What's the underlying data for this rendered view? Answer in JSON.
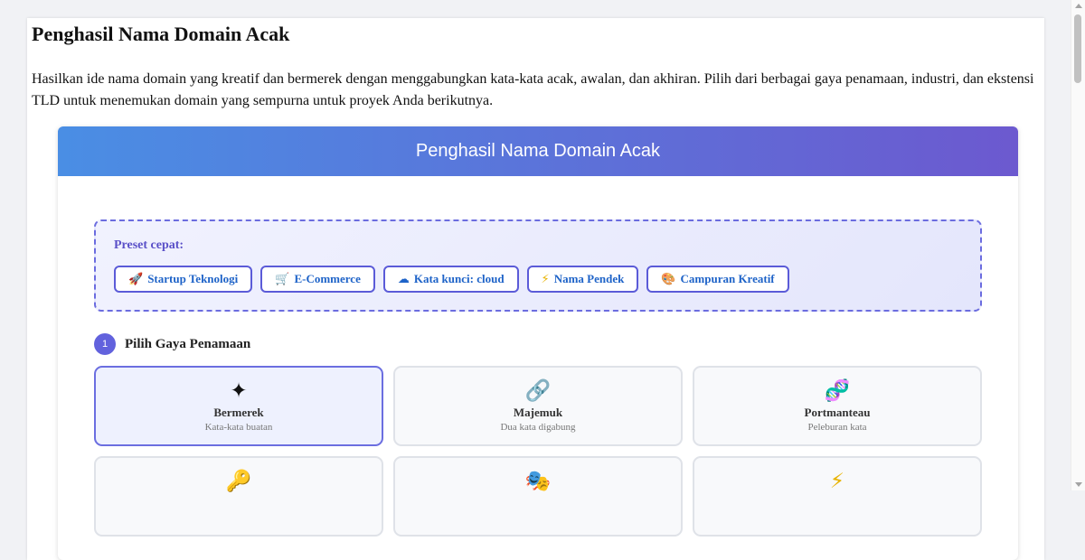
{
  "page": {
    "title": "Penghasil Nama Domain Acak",
    "intro": "Hasilkan ide nama domain yang kreatif dan bermerek dengan menggabungkan kata-kata acak, awalan, dan akhiran. Pilih dari berbagai gaya penamaan, industri, dan ekstensi TLD untuk menemukan domain yang sempurna untuk proyek Anda berikutnya."
  },
  "tool": {
    "header": "Penghasil Nama Domain Acak",
    "presets": {
      "label": "Preset cepat:",
      "items": [
        {
          "icon": "rocket-icon",
          "emoji": "🚀",
          "label": "Startup Teknologi"
        },
        {
          "icon": "cart-icon",
          "emoji": "🛒",
          "label": "E-Commerce"
        },
        {
          "icon": "cloud-icon",
          "emoji": "☁",
          "label": "Kata kunci: cloud"
        },
        {
          "icon": "lightning-icon",
          "emoji": "⚡",
          "label": "Nama Pendek"
        },
        {
          "icon": "palette-icon",
          "emoji": "🎨",
          "label": "Campuran Kreatif"
        }
      ]
    },
    "step1": {
      "number": "1",
      "label": "Pilih Gaya Penamaan",
      "selected": "Bermerek",
      "options": [
        {
          "icon": "sparkle-icon",
          "glyph": "✦",
          "name": "Bermerek",
          "desc": "Kata-kata buatan"
        },
        {
          "icon": "link-icon",
          "glyph": "🔗",
          "name": "Majemuk",
          "desc": "Dua kata digabung"
        },
        {
          "icon": "dna-icon",
          "glyph": "🧬",
          "name": "Portmanteau",
          "desc": "Peleburan kata"
        },
        {
          "icon": "key-icon",
          "glyph": "🔑",
          "name": "",
          "desc": ""
        },
        {
          "icon": "mask-icon",
          "glyph": "🎭",
          "name": "",
          "desc": ""
        },
        {
          "icon": "lightning-icon",
          "glyph": "⚡",
          "name": "",
          "desc": ""
        }
      ]
    }
  },
  "colors": {
    "header_gradient_start": "#4a8ee4",
    "header_gradient_end": "#6c59cf",
    "accent": "#5b5bd8",
    "preset_text": "#1e63c8"
  }
}
